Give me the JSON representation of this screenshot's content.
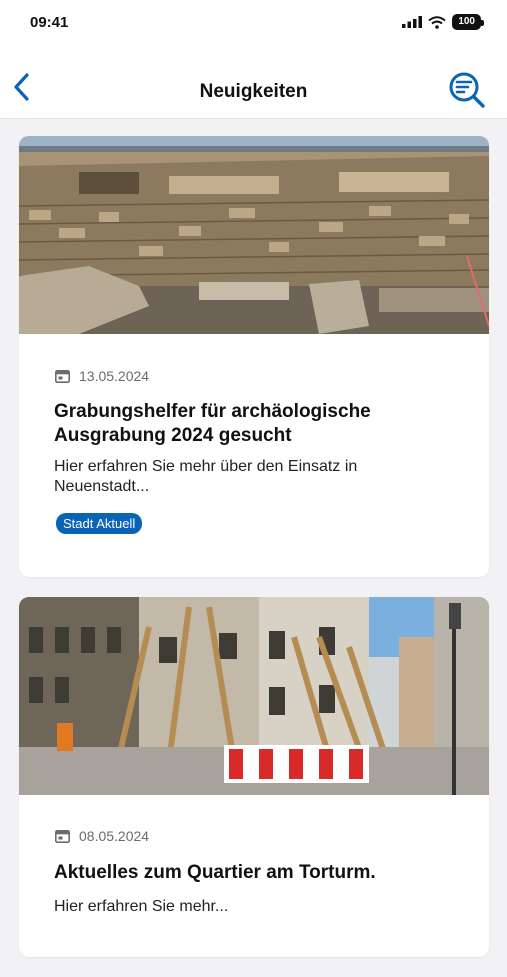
{
  "status": {
    "time": "09:41",
    "battery": "100"
  },
  "header": {
    "title": "Neuigkeiten"
  },
  "colors": {
    "accent": "#0a63b5",
    "background": "#f2f2f4"
  },
  "icons": {
    "back": "chevron-left-icon",
    "search": "search-filter-icon",
    "date": "calendar-icon"
  },
  "articles": [
    {
      "date": "13.05.2024",
      "title": "Grabungshelfer für archäologische Ausgrabung 2024 gesucht",
      "teaser": "Hier erfahren Sie mehr über den Einsatz in Neuenstadt...",
      "tag": "Stadt Aktuell"
    },
    {
      "date": "08.05.2024",
      "title": "Aktuelles zum Quartier am Torturm.",
      "teaser": "Hier erfahren Sie mehr..."
    }
  ]
}
